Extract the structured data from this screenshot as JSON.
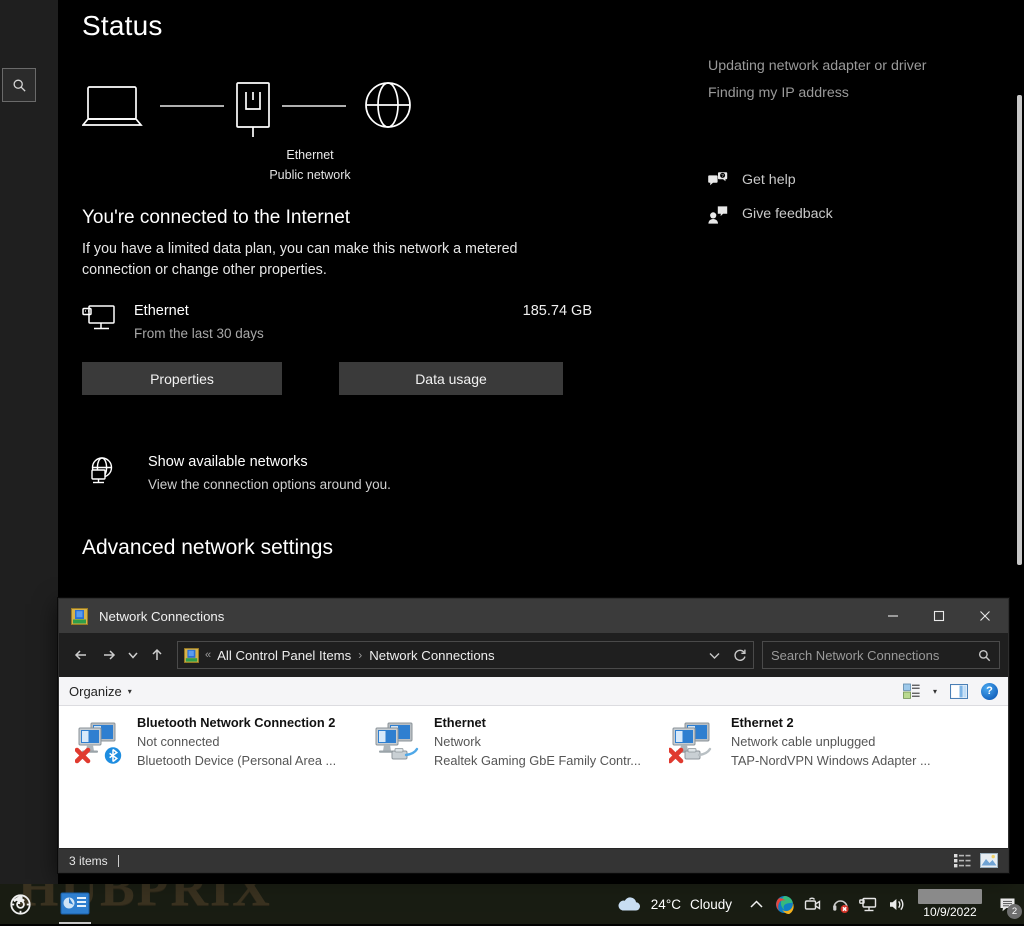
{
  "desktop": {
    "watermark": "HUBPRIX",
    "watermark_color": "#6b5534",
    "background_color": "#1b2113"
  },
  "settings": {
    "nav": {
      "search_icon": "search-icon"
    },
    "page_title": "Status",
    "diagram": {
      "device_icon": "laptop-icon",
      "adapter_icon": "ethernet-port-icon",
      "internet_icon": "globe-icon",
      "adapter_name": "Ethernet",
      "network_type": "Public network"
    },
    "connected_heading": "You're connected to the Internet",
    "connected_description": "If you have a limited data plan, you can make this network a metered connection or change other properties.",
    "usage": {
      "icon": "ethernet-monitor-icon",
      "name": "Ethernet",
      "subtitle": "From the last 30 days",
      "value": "185.74 GB"
    },
    "buttons": {
      "properties": "Properties",
      "data_usage": "Data usage"
    },
    "available_networks": {
      "icon": "globe-monitor-icon",
      "title": "Show available networks",
      "subtitle": "View the connection options around you."
    },
    "advanced_heading": "Advanced network settings",
    "rail_links": [
      "Updating network adapter or driver",
      "Finding my IP address"
    ],
    "help_links": [
      {
        "icon": "chat-help-icon",
        "label": "Get help"
      },
      {
        "icon": "feedback-icon",
        "label": "Give feedback"
      }
    ]
  },
  "explorer": {
    "app_icon": "network-connections-icon",
    "title": "Network Connections",
    "window_controls": {
      "minimize": "minimize-icon",
      "maximize": "maximize-icon",
      "close": "close-icon"
    },
    "nav": {
      "back": "back-arrow-icon",
      "forward": "forward-arrow-icon",
      "recent": "chevron-down-icon",
      "up": "up-arrow-icon"
    },
    "address": {
      "icon": "network-connections-icon",
      "overflow": "«",
      "crumbs": [
        "All Control Panel Items",
        "Network Connections"
      ],
      "separator": "›",
      "dropdown_icon": "chevron-down-icon",
      "refresh_icon": "refresh-icon"
    },
    "search": {
      "placeholder": "Search Network Connections",
      "value": "",
      "icon": "search-icon"
    },
    "toolbar": {
      "organize_label": "Organize",
      "organize_caret": "▾",
      "view_icon": "change-view-icon",
      "view_caret": "▾",
      "preview_pane_icon": "preview-pane-icon",
      "help_icon": "help-icon",
      "help_glyph": "?"
    },
    "connections": [
      {
        "name": "Bluetooth Network Connection 2",
        "status": "Not connected",
        "device": "Bluetooth Device (Personal Area ...",
        "icon": "network-adapter-icon",
        "overlay": "red-x-icon",
        "badge": "bluetooth-icon"
      },
      {
        "name": "Ethernet",
        "status": "Network",
        "device": "Realtek Gaming GbE Family Contr...",
        "icon": "network-adapter-icon",
        "overlay": "cable-icon",
        "badge": ""
      },
      {
        "name": "Ethernet 2",
        "status": "Network cable unplugged",
        "device": "TAP-NordVPN Windows Adapter ...",
        "icon": "network-adapter-icon",
        "overlay": "red-x-icon",
        "badge": "cable-icon"
      }
    ],
    "status_bar": {
      "items_count": "3 items",
      "details_view_icon": "details-view-icon",
      "large_icons_view_icon": "large-icons-view-icon"
    }
  },
  "taskbar": {
    "start_icon": "windows-start-icon",
    "pinned_icon": "control-panel-icon",
    "weather": {
      "icon": "cloud-icon",
      "temperature": "24°C",
      "description": "Cloudy"
    },
    "tray_icons": [
      {
        "name": "show-hidden-icons-chevron-icon",
        "glyph": "∧"
      },
      {
        "name": "edge-browser-icon",
        "glyph": ""
      },
      {
        "name": "camera-icon",
        "glyph": ""
      },
      {
        "name": "headset-muted-icon",
        "glyph": ""
      },
      {
        "name": "network-icon",
        "glyph": ""
      },
      {
        "name": "volume-icon",
        "glyph": ""
      }
    ],
    "clock": {
      "time_redacted": true,
      "date": "10/9/2022"
    },
    "notifications": {
      "icon": "notification-icon",
      "count": "2"
    }
  }
}
